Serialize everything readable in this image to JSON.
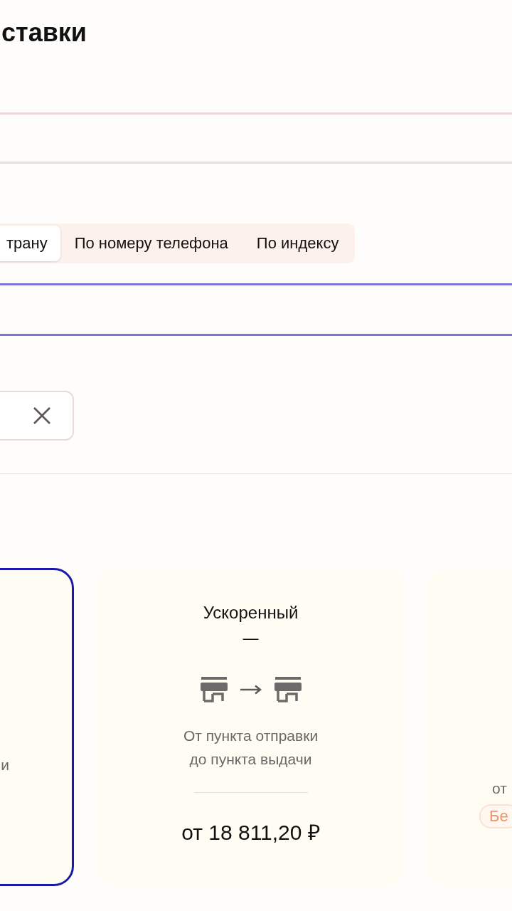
{
  "page_title": "ставки",
  "search_tabs": [
    {
      "label": "трану",
      "selected": true
    },
    {
      "label": "По номеру телефона",
      "selected": false
    },
    {
      "label": "По индексу",
      "selected": false
    }
  ],
  "search_field": {
    "focused": true
  },
  "tariffs": [
    {
      "kind": "cut",
      "selected": true,
      "description": "и"
    },
    {
      "kind": "detailed",
      "selected": false,
      "title": "Ускоренный",
      "term": "—",
      "description": "От пункта отправки\nдо пункта выдачи",
      "price": "от 18 811,20 ₽"
    },
    {
      "kind": "cut",
      "selected": false,
      "description": "от",
      "badge": "Бе"
    }
  ]
}
